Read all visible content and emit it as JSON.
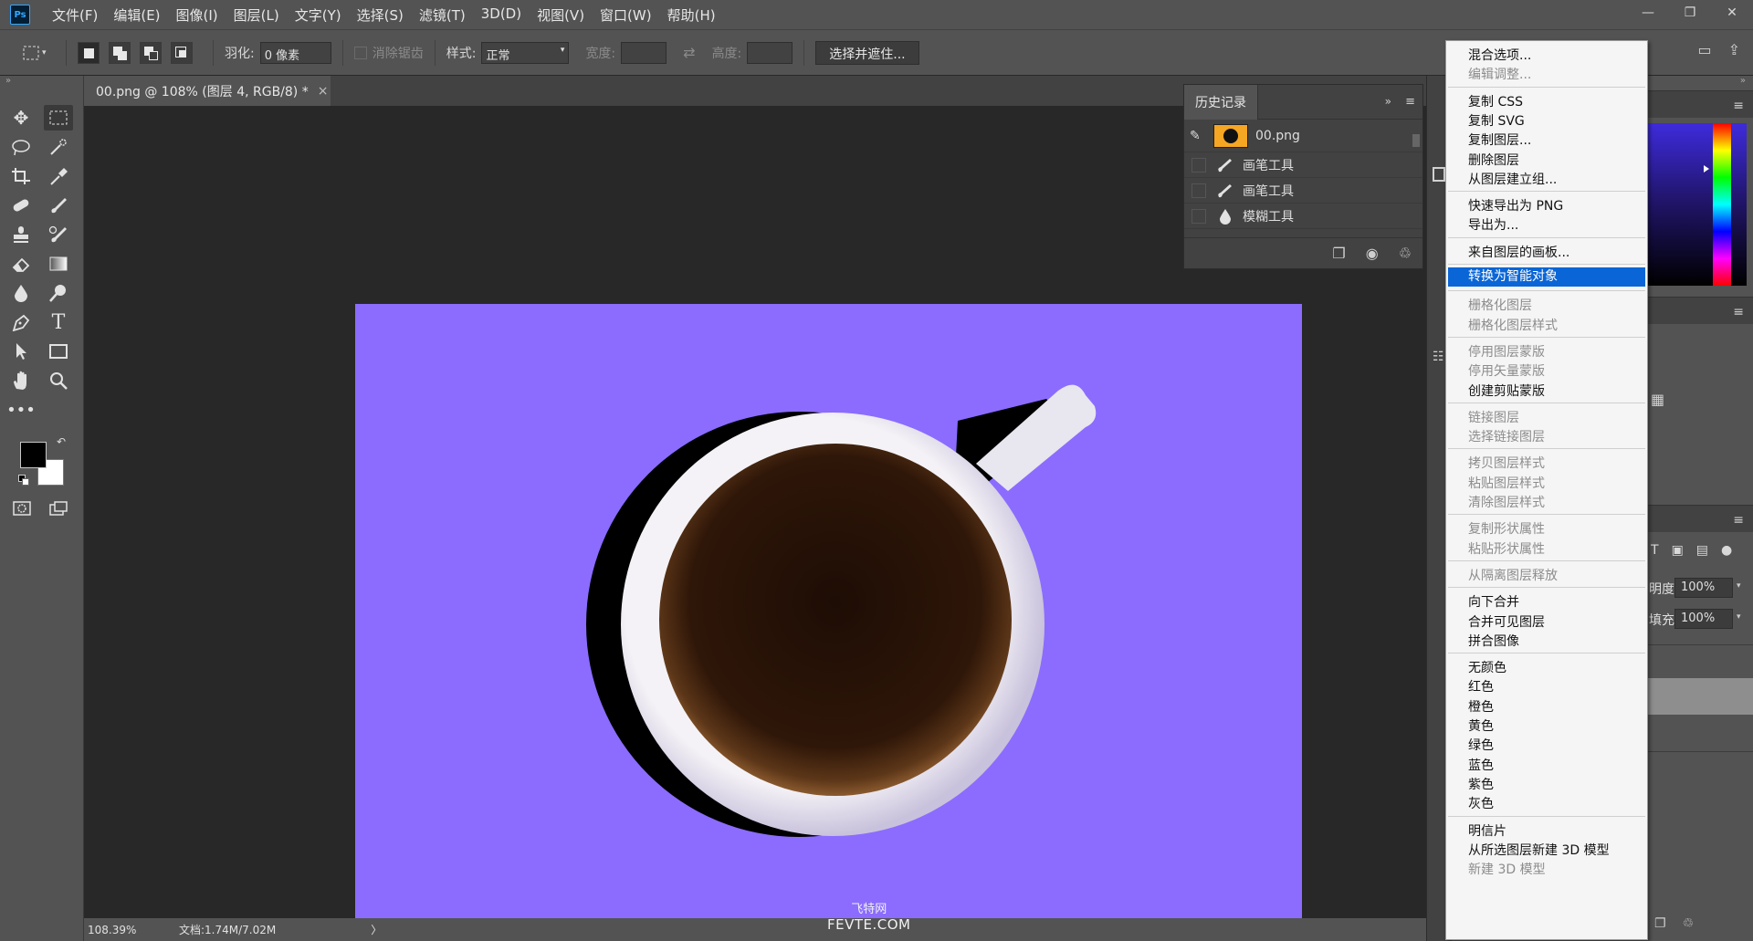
{
  "app": {
    "logo": "Ps"
  },
  "menubar": {
    "items": [
      "文件(F)",
      "编辑(E)",
      "图像(I)",
      "图层(L)",
      "文字(Y)",
      "选择(S)",
      "滤镜(T)",
      "3D(D)",
      "视图(V)",
      "窗口(W)",
      "帮助(H)"
    ]
  },
  "options": {
    "feather_label": "羽化:",
    "feather_value": "0 像素",
    "antialias_label": "消除锯齿",
    "style_label": "样式:",
    "style_value": "正常",
    "width_label": "宽度:",
    "height_label": "高度:",
    "select_mask_button": "选择并遮住..."
  },
  "document": {
    "tab_title": "00.png @ 108% (图层 4, RGB/8) *",
    "close_symbol": "×",
    "zoom": "108.39%",
    "doc_info": "文档:1.74M/7.02M",
    "canvas_color": "#8b6cff"
  },
  "history": {
    "title": "历史记录",
    "snapshot": "00.png",
    "steps": [
      "画笔工具",
      "画笔工具",
      "模糊工具"
    ]
  },
  "right_panel": {
    "opacity_label": "明度:",
    "opacity_value": "100%",
    "fill_label": "填充:",
    "fill_value": "100%"
  },
  "context_menu": {
    "groups": [
      [
        {
          "label": "混合选项...",
          "enabled": true
        },
        {
          "label": "编辑调整...",
          "enabled": false
        }
      ],
      [
        {
          "label": "复制 CSS",
          "enabled": true
        },
        {
          "label": "复制 SVG",
          "enabled": true
        },
        {
          "label": "复制图层...",
          "enabled": true
        },
        {
          "label": "删除图层",
          "enabled": true
        },
        {
          "label": "从图层建立组...",
          "enabled": true
        }
      ],
      [
        {
          "label": "快速导出为 PNG",
          "enabled": true
        },
        {
          "label": "导出为...",
          "enabled": true
        }
      ],
      [
        {
          "label": "来自图层的画板...",
          "enabled": true
        }
      ],
      [
        {
          "label": "转换为智能对象",
          "enabled": true,
          "highlighted": true
        }
      ],
      [
        {
          "label": "栅格化图层",
          "enabled": false
        },
        {
          "label": "栅格化图层样式",
          "enabled": false
        }
      ],
      [
        {
          "label": "停用图层蒙版",
          "enabled": false
        },
        {
          "label": "停用矢量蒙版",
          "enabled": false
        },
        {
          "label": "创建剪贴蒙版",
          "enabled": true
        }
      ],
      [
        {
          "label": "链接图层",
          "enabled": false
        },
        {
          "label": "选择链接图层",
          "enabled": false
        }
      ],
      [
        {
          "label": "拷贝图层样式",
          "enabled": false
        },
        {
          "label": "粘贴图层样式",
          "enabled": false
        },
        {
          "label": "清除图层样式",
          "enabled": false
        }
      ],
      [
        {
          "label": "复制形状属性",
          "enabled": false
        },
        {
          "label": "粘贴形状属性",
          "enabled": false
        }
      ],
      [
        {
          "label": "从隔离图层释放",
          "enabled": false
        }
      ],
      [
        {
          "label": "向下合并",
          "enabled": true
        },
        {
          "label": "合并可见图层",
          "enabled": true
        },
        {
          "label": "拼合图像",
          "enabled": true
        }
      ],
      [
        {
          "label": "无颜色",
          "enabled": true
        },
        {
          "label": "红色",
          "enabled": true
        },
        {
          "label": "橙色",
          "enabled": true
        },
        {
          "label": "黄色",
          "enabled": true
        },
        {
          "label": "绿色",
          "enabled": true
        },
        {
          "label": "蓝色",
          "enabled": true
        },
        {
          "label": "紫色",
          "enabled": true
        },
        {
          "label": "灰色",
          "enabled": true
        }
      ],
      [
        {
          "label": "明信片",
          "enabled": true
        },
        {
          "label": "从所选图层新建 3D 模型",
          "enabled": true
        },
        {
          "label": "新建 3D 模型",
          "enabled": false
        }
      ]
    ]
  },
  "watermark": {
    "line1": "飞特网",
    "line2": "FEVTE.COM"
  }
}
